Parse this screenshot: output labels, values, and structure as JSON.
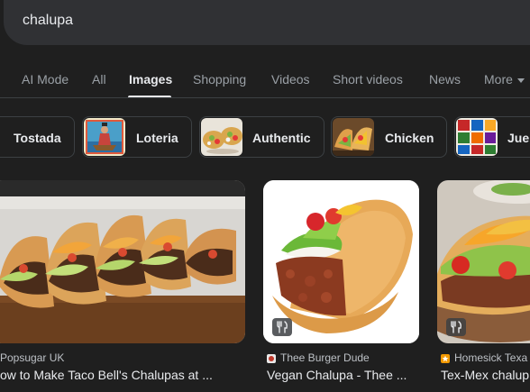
{
  "search": {
    "query": "chalupa"
  },
  "tabs": [
    {
      "label": "AI Mode"
    },
    {
      "label": "All"
    },
    {
      "label": "Images"
    },
    {
      "label": "Shopping"
    },
    {
      "label": "Videos"
    },
    {
      "label": "Short videos"
    },
    {
      "label": "News"
    },
    {
      "label": "More"
    }
  ],
  "chips": [
    {
      "label": "Tostada"
    },
    {
      "label": "Loteria"
    },
    {
      "label": "Authentic"
    },
    {
      "label": "Chicken"
    },
    {
      "label": "Jue"
    }
  ],
  "results": [
    {
      "source": "Popsugar UK",
      "title": "ow to Make Taco Bell's Chalupas at ..."
    },
    {
      "source": "Thee Burger Dude",
      "title": "Vegan Chalupa - Thee ..."
    },
    {
      "source": "Homesick Texa",
      "title": "Tex-Mex chalup"
    }
  ],
  "colors": {
    "background": "#1f1f1f",
    "search_bar": "#303134",
    "text_primary": "#e8eaed",
    "text_secondary": "#9aa0a6"
  },
  "icons": {
    "badge": "utensils-icon",
    "more": "chevron-down-icon"
  }
}
